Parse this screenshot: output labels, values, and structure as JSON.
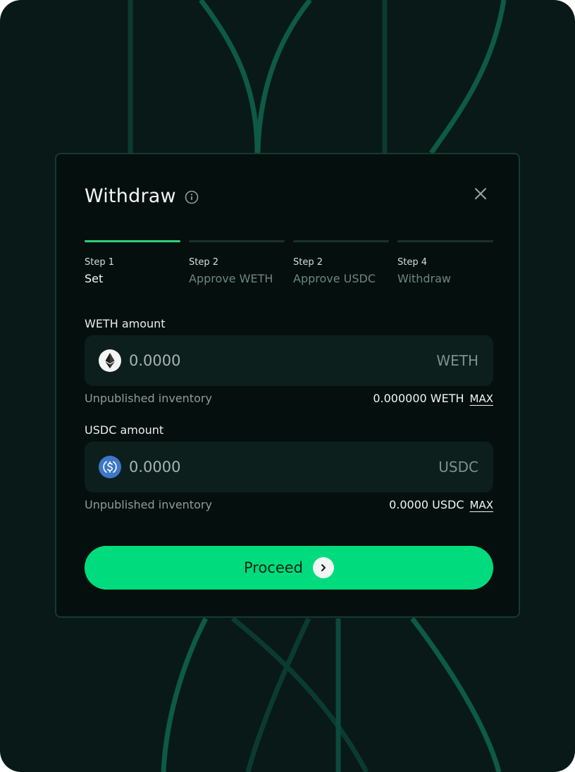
{
  "modal": {
    "title": "Withdraw"
  },
  "steps": [
    {
      "number": "Step 1",
      "name": "Set",
      "active": true
    },
    {
      "number": "Step 2",
      "name": "Approve WETH",
      "active": false
    },
    {
      "number": "Step 2",
      "name": "Approve USDC",
      "active": false
    },
    {
      "number": "Step 4",
      "name": "Withdraw",
      "active": false
    }
  ],
  "weth": {
    "label": "WETH amount",
    "placeholder": "0.0000",
    "unit": "WETH",
    "meta_label": "Unpublished inventory",
    "balance": "0.000000 WETH",
    "max_label": "MAX",
    "icon": "ethereum-icon"
  },
  "usdc": {
    "label": "USDC amount",
    "placeholder": "0.0000",
    "unit": "USDC",
    "meta_label": "Unpublished inventory",
    "balance": "0.0000 USDC",
    "max_label": "MAX",
    "icon": "usdc-icon"
  },
  "proceed": {
    "label": "Proceed"
  },
  "colors": {
    "accent": "#00dc7d",
    "active_step": "#2fd07a",
    "background": "#081918",
    "modal": "#040f0e",
    "usdc_blue": "#3d77c8"
  }
}
